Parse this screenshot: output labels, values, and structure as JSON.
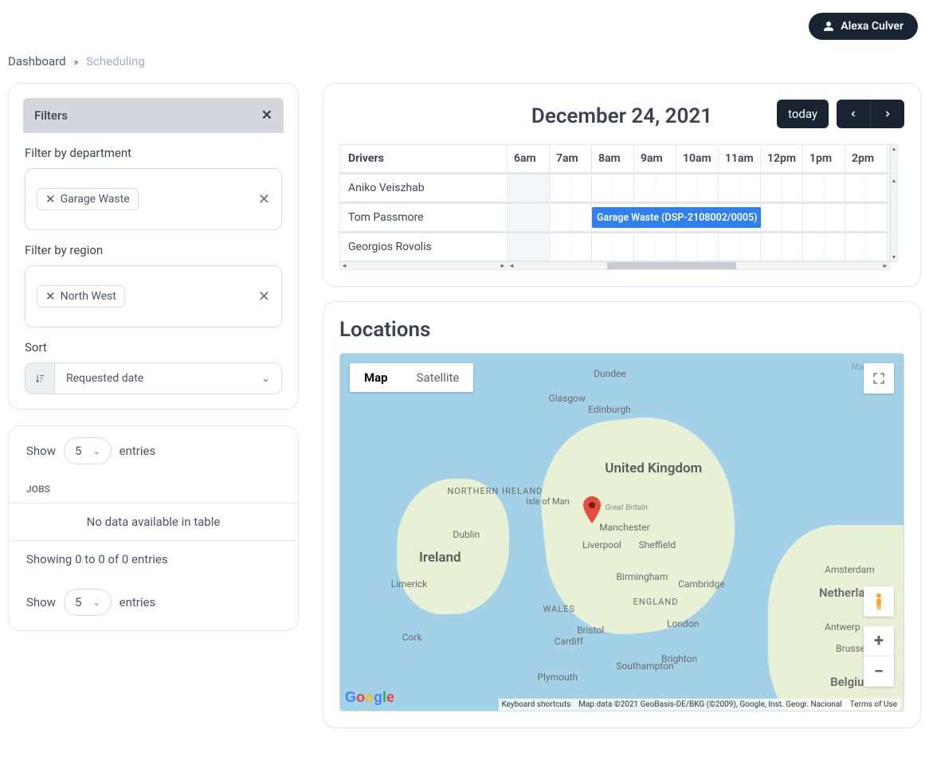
{
  "header": {
    "user_name": "Alexa Culver"
  },
  "breadcrumb": {
    "root": "Dashboard",
    "current": "Scheduling"
  },
  "filters": {
    "title": "Filters",
    "department_label": "Filter by department",
    "department_tags": [
      "Garage Waste"
    ],
    "region_label": "Filter by region",
    "region_tags": [
      "North West"
    ],
    "sort_label": "Sort",
    "sort_value": "Requested date"
  },
  "table": {
    "show_label": "Show",
    "entries_label": "entries",
    "page_size": "5",
    "jobs_header": "JOBS",
    "no_data": "No data available in table",
    "footer": "Showing 0 to 0 of 0 entries"
  },
  "calendar": {
    "title": "December 24, 2021",
    "today_label": "today",
    "drivers_header": "Drivers",
    "hours": [
      "6am",
      "7am",
      "8am",
      "9am",
      "10am",
      "11am",
      "12pm",
      "1pm",
      "2pm"
    ],
    "drivers": [
      "Aniko Veiszhab",
      "Tom Passmore",
      "Georgios Rovolis"
    ],
    "event_label": "Garage Waste (DSP-2108002/0005)"
  },
  "locations": {
    "title": "Locations",
    "map_type_map": "Map",
    "map_type_sat": "Satellite",
    "keyboard_shortcuts": "Keyboard shortcuts",
    "attribution": "Map data ©2021 GeoBasis-DE/BKG (©2009), Google, Inst. Geogr. Nacional",
    "terms": "Terms of Use",
    "labels": {
      "uk": "United Kingdom",
      "ireland": "Ireland",
      "n_ireland": "NORTHERN IRELAND",
      "wales": "WALES",
      "england": "ENGLAND",
      "north_sea": "North Sea",
      "isle_of_man": "Isle of Man",
      "gb": "Great Britain",
      "netherlands": "Netherlands",
      "belgium": "Belgium"
    },
    "cities": {
      "dublin": "Dublin",
      "glasgow": "Glasgow",
      "edinburgh": "Edinburgh",
      "liverpool": "Liverpool",
      "manchester": "Manchester",
      "sheffield": "Sheffield",
      "birmingham": "Birmingham",
      "london": "London",
      "bristol": "Bristol",
      "cardiff": "Cardiff",
      "amsterdam": "Amsterdam",
      "brussels": "Brussels",
      "antwerp": "Antwerp",
      "limerick": "Limerick",
      "cork": "Cork",
      "plymouth": "Plymouth",
      "southampton": "Southampton",
      "brighton": "Brighton",
      "cambridge": "Cambridge",
      "dundee": "Dundee"
    }
  }
}
